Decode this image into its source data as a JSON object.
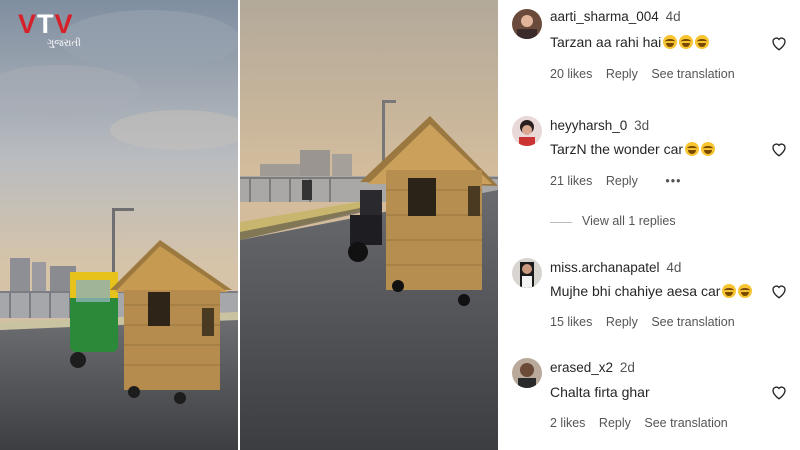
{
  "brand": {
    "logo_text": "VTV",
    "logo_sub": "ગુજરાતી",
    "colors": {
      "logo_red": "#d6202a",
      "logo_white": "#ffffff"
    }
  },
  "comments": [
    {
      "username": "aarti_sharma_004",
      "time": "4d",
      "text": "Tarzan aa rahi hai",
      "emoji_count": 3,
      "likes": "20 likes",
      "reply": "Reply",
      "translation": "See translation",
      "avatar_icon": "profile-photo"
    },
    {
      "username": "heyyharsh_0",
      "time": "3d",
      "text": "TarzN the wonder car",
      "emoji_count": 2,
      "likes": "21 likes",
      "reply": "Reply",
      "more": "•••",
      "avatar_icon": "profile-photo"
    },
    {
      "username": "miss.archanapatel",
      "time": "4d",
      "text": "Mujhe bhi chahiye aesa car",
      "emoji_count": 2,
      "likes": "15 likes",
      "reply": "Reply",
      "translation": "See translation",
      "avatar_icon": "profile-photo"
    },
    {
      "username": "erased_x2",
      "time": "2d",
      "text": "Chalta firta ghar",
      "emoji_count": 0,
      "likes": "2 likes",
      "reply": "Reply",
      "translation": "See translation",
      "avatar_icon": "profile-photo"
    }
  ],
  "view_replies": "View all 1 replies",
  "icons": {
    "like": "heart-outline-icon",
    "emoji": "laughing-emoji-icon"
  }
}
